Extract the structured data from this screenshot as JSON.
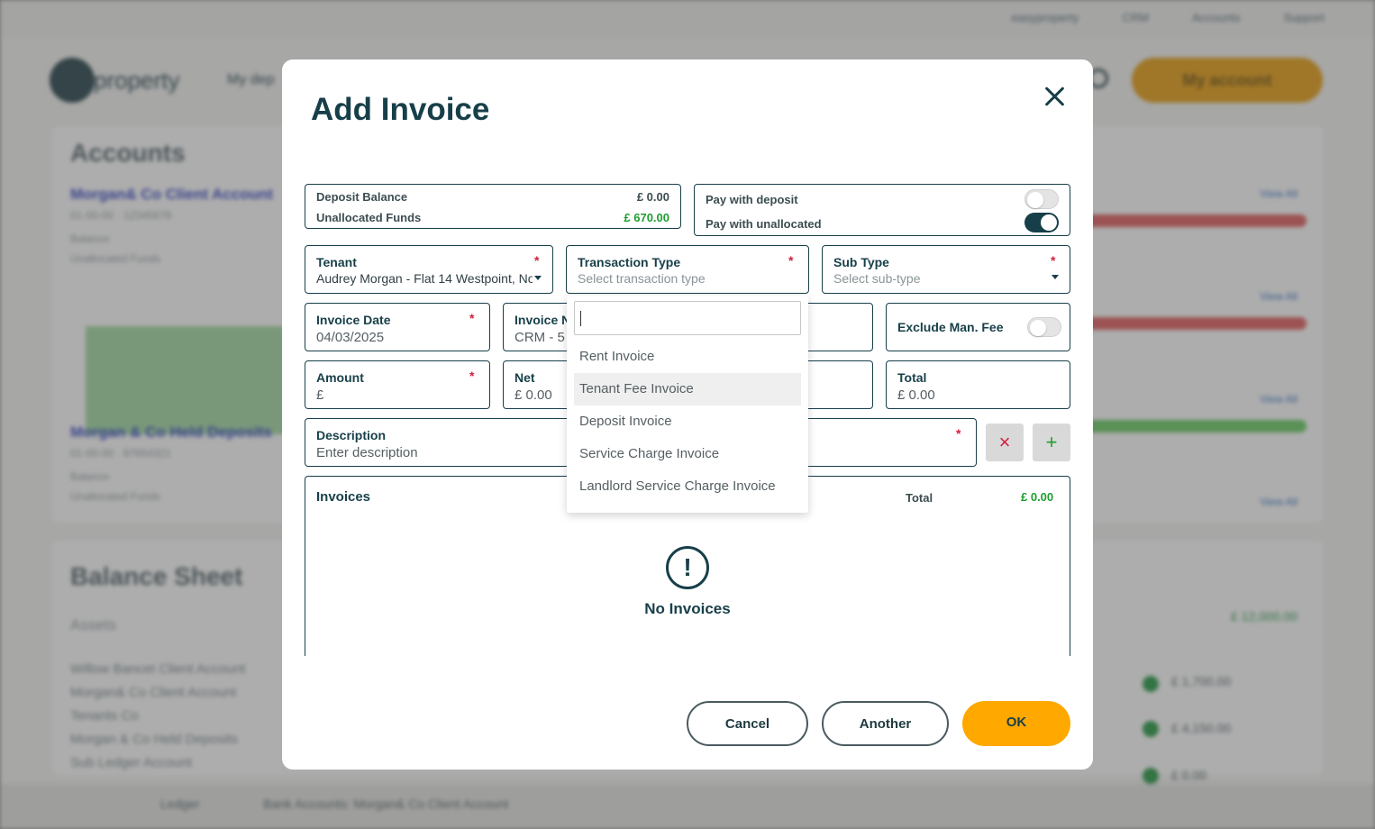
{
  "background": {
    "top_links": [
      "easyproperty",
      "CRM",
      "Accounts",
      "Support"
    ],
    "logo_text": "property",
    "nav_label": "My dep",
    "account_button": "My account",
    "accounts_title": "Accounts",
    "account_1_name": "Morgan& Co Client Account",
    "account_1_sub": "01-00-00 · 12345678",
    "balance_label": "Balance",
    "unallocated_label": "Unallocated Funds",
    "account_2_name": "Morgan & Co Held Deposits",
    "account_2_sub": "01-00-00 · 87654321",
    "balance_sheet_title": "Balance Sheet",
    "assets_label": "Assets",
    "assets_value": "£ 12,000.00",
    "list_items": [
      "Willow Bancet Client Account",
      "Morgan& Co Client Account",
      "Tenants Co",
      "Morgan & Co Held Deposits",
      "Sub Ledger Account"
    ],
    "right_values": [
      "£ 1,700.00",
      "£ 4,150.00",
      "£ 0.00"
    ],
    "view_all": "View All",
    "bottom_items": [
      "Ledger",
      "Bank Accounts: Morgan& Co Client Account"
    ]
  },
  "modal": {
    "title": "Add Invoice",
    "deposit_balance_label": "Deposit Balance",
    "deposit_balance_value": "£ 0.00",
    "unallocated_funds_label": "Unallocated Funds",
    "unallocated_funds_value": "£ 670.00",
    "pay_with_deposit_label": "Pay with deposit",
    "pay_with_deposit_on": false,
    "pay_with_unallocated_label": "Pay with unallocated",
    "pay_with_unallocated_on": true,
    "tenant_label": "Tenant",
    "tenant_value": "Audrey Morgan - Flat 14 Westpoint, No",
    "transaction_type_label": "Transaction Type",
    "transaction_type_placeholder": "Select transaction type",
    "sub_type_label": "Sub Type",
    "sub_type_placeholder": "Select sub-type",
    "invoice_date_label": "Invoice Date",
    "invoice_date_value": "04/03/2025",
    "invoice_no_label": "Invoice N",
    "invoice_no_value": "CRM - 5",
    "exclude_fee_label": "Exclude Man. Fee",
    "exclude_fee_on": false,
    "amount_label": "Amount",
    "amount_value": "£",
    "net_label": "Net",
    "net_value": "£ 0.00",
    "total_field_label": "Total",
    "total_field_value": "£ 0.00",
    "description_label": "Description",
    "description_placeholder": "Enter description",
    "required_mark": "*",
    "remove_symbol": "×",
    "add_symbol": "+",
    "invoices_label": "Invoices",
    "invoices_total_label": "Total",
    "invoices_total_value": "£ 0.00",
    "empty_icon_glyph": "!",
    "empty_text": "No Invoices",
    "cancel_label": "Cancel",
    "another_label": "Another",
    "ok_label": "OK"
  },
  "dropdown": {
    "search_value": "",
    "options": [
      "Rent Invoice",
      "Tenant Fee Invoice",
      "Deposit Invoice",
      "Service Charge Invoice",
      "Landlord Service Charge Invoice"
    ],
    "highlighted": "Tenant Fee Invoice"
  },
  "colors": {
    "primary": "#173f49",
    "accent": "#fea800",
    "required": "#d0213d",
    "positive": "#1e9e2e"
  },
  "icons": [
    "close-icon",
    "caret-down-icon",
    "exclamation-circle-icon",
    "times-icon",
    "plus-icon"
  ]
}
